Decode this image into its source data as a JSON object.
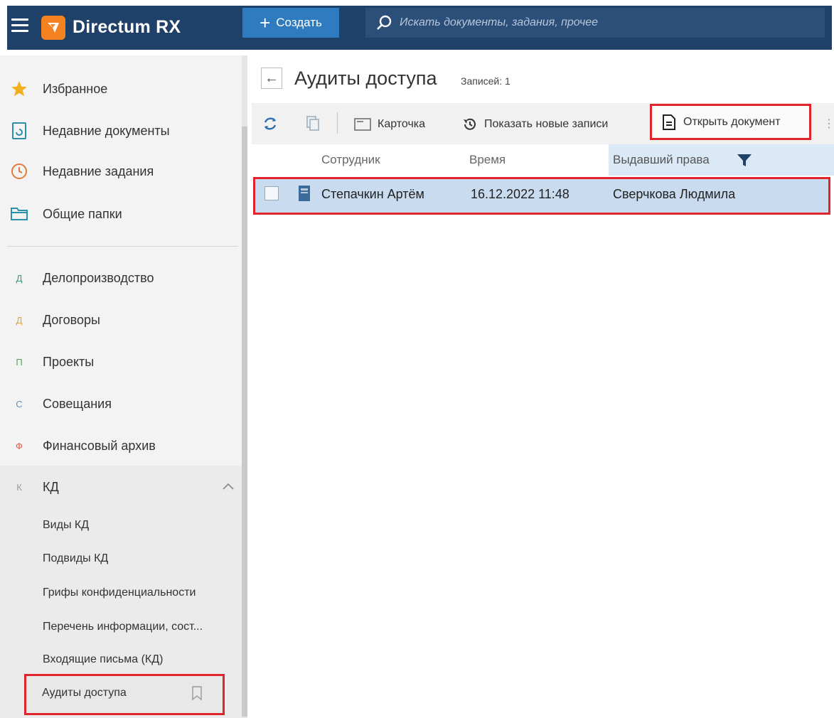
{
  "app": {
    "title": "Directum RX",
    "create_label": "Создать",
    "search_placeholder": "Искать документы, задания, прочее"
  },
  "sidebar": {
    "items": [
      {
        "label": "Избранное",
        "icon": "star-icon"
      },
      {
        "label": "Недавние документы",
        "icon": "recent-documents-icon"
      },
      {
        "label": "Недавние задания",
        "icon": "clock-icon"
      },
      {
        "label": "Общие папки",
        "icon": "folder-icon"
      }
    ],
    "modules": [
      {
        "letter": "Д",
        "label": "Делопроизводство",
        "color": "#3a9a7a"
      },
      {
        "letter": "Д",
        "label": "Договоры",
        "color": "#e3a630"
      },
      {
        "letter": "П",
        "label": "Проекты",
        "color": "#5aa55a"
      },
      {
        "letter": "С",
        "label": "Совещания",
        "color": "#6f8fb0"
      },
      {
        "letter": "Ф",
        "label": "Финансовый архив",
        "color": "#e05a4c"
      },
      {
        "letter": "К",
        "label": "КД",
        "color": "#9a9a9a"
      }
    ],
    "kd_subitems": [
      "Виды КД",
      "Подвиды КД",
      "Грифы конфиденциальности",
      "Перечень информации, сост...",
      "Входящие письма (КД)",
      "Аудиты доступа"
    ]
  },
  "main": {
    "title": "Аудиты доступа",
    "records": "Записей: 1",
    "toolbar": {
      "card": "Карточка",
      "show_new": "Показать новые записи",
      "open_document": "Открыть документ",
      "more": "⋮"
    },
    "columns": [
      "Сотрудник",
      "Время",
      "Выдавший права"
    ],
    "rows": [
      {
        "employee": "Степачкин Артём",
        "time": "16.12.2022 11:48",
        "granted_by": "Сверчкова Людмила"
      }
    ]
  },
  "colors": {
    "topbar": "#1f4069",
    "accent": "#2e7bbf",
    "highlight": "#e0242c",
    "selected_row": "#c9dcef"
  }
}
